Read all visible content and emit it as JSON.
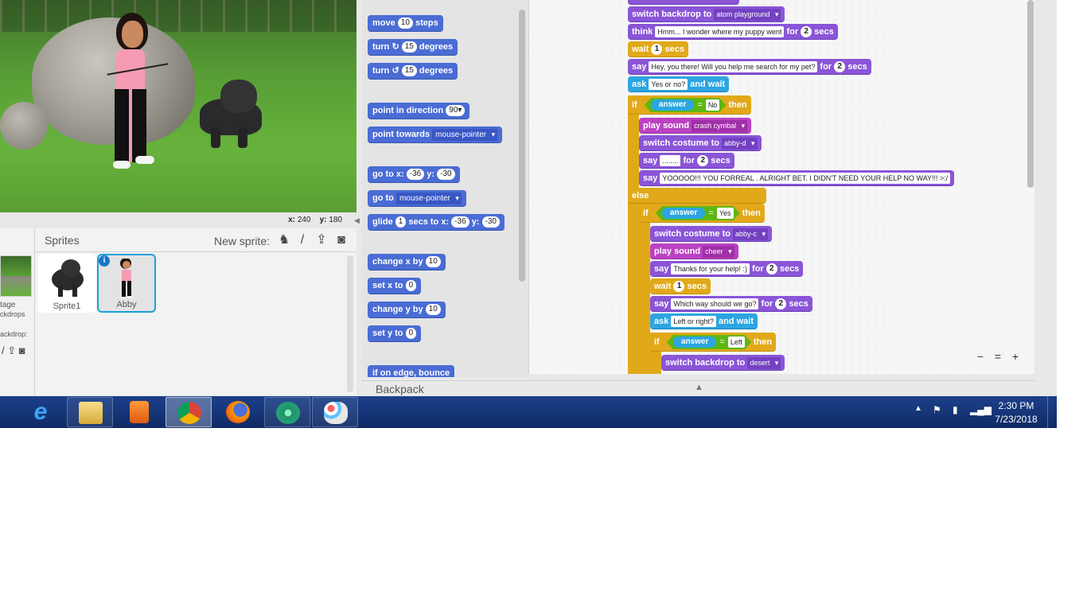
{
  "stage": {
    "coords": {
      "x_label": "x:",
      "x_value": "240",
      "y_label": "y:",
      "y_value": "180"
    }
  },
  "sprites_pane": {
    "title": "Sprites",
    "new_sprite_label": "New sprite:",
    "stage_label_line1": "tage",
    "stage_label_line2": "ckdrops",
    "new_backdrop_label": "ackdrop:",
    "sprites": [
      {
        "name": "Sprite1",
        "selected": false
      },
      {
        "name": "Abby",
        "selected": true
      }
    ],
    "info_badge": "i"
  },
  "palette": {
    "blocks": [
      {
        "parts": [
          "move",
          "10",
          "steps"
        ]
      },
      {
        "parts": [
          "turn ↻",
          "15",
          "degrees"
        ]
      },
      {
        "parts": [
          "turn ↺",
          "15",
          "degrees"
        ]
      },
      {
        "parts": [
          "point in direction",
          "90▾"
        ]
      },
      {
        "parts": [
          "point towards",
          "mouse-pointer"
        ]
      },
      {
        "parts": [
          "go to x:",
          "-36",
          "y:",
          "-30"
        ]
      },
      {
        "parts": [
          "go to",
          "mouse-pointer"
        ]
      },
      {
        "parts": [
          "glide",
          "1",
          "secs to x:",
          "-36",
          "y:",
          "-30"
        ]
      },
      {
        "parts": [
          "change x by",
          "10"
        ]
      },
      {
        "parts": [
          "set x to",
          "0"
        ]
      },
      {
        "parts": [
          "change y by",
          "10"
        ]
      },
      {
        "parts": [
          "set y to",
          "0"
        ]
      },
      {
        "parts": [
          "if on edge, bounce"
        ]
      }
    ]
  },
  "script": {
    "b1": {
      "label": "switch backdrop to",
      "value": "atom playground"
    },
    "b2": {
      "label": "think",
      "text": "Hmm... I wonder where my puppy went",
      "for": "for",
      "secs_val": "2",
      "secs": "secs"
    },
    "b3": {
      "label": "wait",
      "val": "1",
      "secs": "secs"
    },
    "b4": {
      "label": "say",
      "text": "Hey, you there! Will you help me search for my pet?",
      "for": "for",
      "secs_val": "2",
      "secs": "secs"
    },
    "b5": {
      "label": "ask",
      "text": "Yes or no?",
      "tail": "and wait"
    },
    "if1": {
      "if": "if",
      "reporter": "answer",
      "eq": "=",
      "value": "No",
      "then": "then"
    },
    "b6": {
      "label": "play sound",
      "value": "crash cymbal"
    },
    "b7": {
      "label": "switch costume to",
      "value": "abby-d"
    },
    "b8": {
      "label": "say",
      "text": "........",
      "for": "for",
      "secs_val": "2",
      "secs": "secs"
    },
    "b9": {
      "label": "say",
      "text": "YOOOOO!!! YOU FORREAL . ALRIGHT BET. I DIDN'T NEED YOUR HELP NO WAY!!! >:/"
    },
    "else": "else",
    "if2": {
      "if": "if",
      "reporter": "answer",
      "eq": "=",
      "value": "Yes",
      "then": "then"
    },
    "b10": {
      "label": "switch costume to",
      "value": "abby-c"
    },
    "b11": {
      "label": "play sound",
      "value": "cheer"
    },
    "b12": {
      "label": "say",
      "text": "Thanks for your help! :)",
      "for": "for",
      "secs_val": "2",
      "secs": "secs"
    },
    "b13": {
      "label": "wait",
      "val": "1",
      "secs": "secs"
    },
    "b14": {
      "label": "say",
      "text": "Which way should we go?",
      "for": "for",
      "secs_val": "2",
      "secs": "secs"
    },
    "b15": {
      "label": "ask",
      "text": "Left or right?",
      "tail": "and wait"
    },
    "if3": {
      "if": "if",
      "reporter": "answer",
      "eq": "=",
      "value": "Left",
      "then": "then"
    },
    "b16": {
      "label": "switch backdrop to",
      "value": "desert"
    }
  },
  "zoom": {
    "out": "−",
    "reset": "=",
    "in": "+"
  },
  "backpack": {
    "label": "Backpack",
    "arrow": "▲"
  },
  "taskbar": {
    "apps": [
      "internet-explorer",
      "file-explorer",
      "media-player",
      "chrome",
      "firefox",
      "atom",
      "paint"
    ],
    "tray_arrow": "▲",
    "time": "2:30 PM",
    "date": "7/23/2018"
  },
  "colors": {
    "motion": "#4a6cd4",
    "looks": "#8a55d7",
    "control": "#e1a91a",
    "sensing": "#2ca5e2",
    "sound": "#bb42c3",
    "operators": "#5cb712",
    "selection": "#1aa0d8"
  }
}
